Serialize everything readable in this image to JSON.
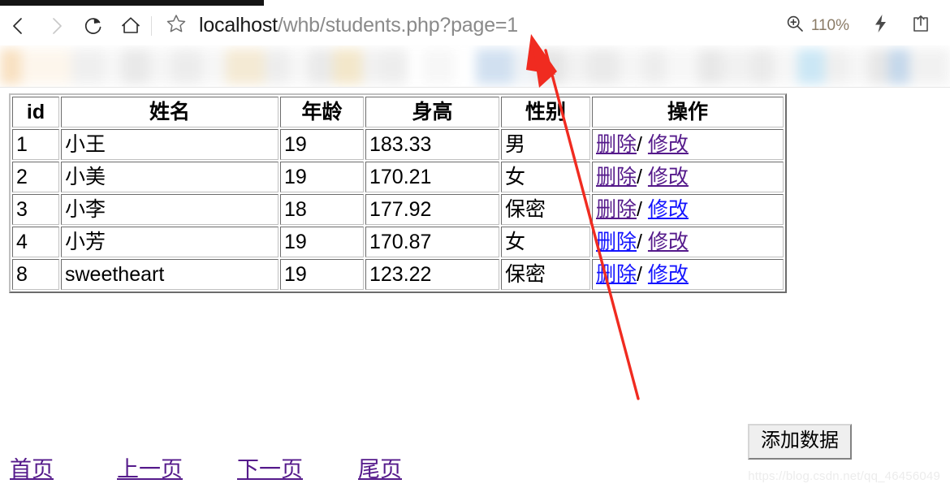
{
  "browser": {
    "back_icon": "chevron-left-icon",
    "forward_icon": "chevron-right-icon",
    "reload_icon": "reload-icon",
    "home_icon": "home-icon",
    "favorite_icon": "star-icon",
    "url_host": "localhost",
    "url_path": "/whb/students.php?page=1",
    "url_full": "localhost/whb/students.php?page=1",
    "zoom_icon": "zoom-in-icon",
    "zoom_level": "110%",
    "reading_view_icon": "lightning-bolt-icon",
    "share_icon": "share-icon"
  },
  "table": {
    "headers": [
      "id",
      "姓名",
      "年龄",
      "身高",
      "性别",
      "操作"
    ],
    "rows": [
      {
        "id": "1",
        "name": "小王",
        "age": "19",
        "height": "183.33",
        "gender": "男",
        "delete": "删除",
        "separator": "/",
        "edit": "修改",
        "delete_state": "visited",
        "edit_state": "visited"
      },
      {
        "id": "2",
        "name": "小美",
        "age": "19",
        "height": "170.21",
        "gender": "女",
        "delete": "删除",
        "separator": "/",
        "edit": "修改",
        "delete_state": "visited",
        "edit_state": "visited"
      },
      {
        "id": "3",
        "name": "小李",
        "age": "18",
        "height": "177.92",
        "gender": "保密",
        "delete": "删除",
        "separator": "/",
        "edit": "修改",
        "delete_state": "visited",
        "edit_state": "unvisited"
      },
      {
        "id": "4",
        "name": "小芳",
        "age": "19",
        "height": "170.87",
        "gender": "女",
        "delete": "删除",
        "separator": "/",
        "edit": "修改",
        "delete_state": "unvisited",
        "edit_state": "visited"
      },
      {
        "id": "8",
        "name": "sweetheart",
        "age": "19",
        "height": "123.22",
        "gender": "保密",
        "delete": "删除",
        "separator": "/",
        "edit": "修改",
        "delete_state": "unvisited",
        "edit_state": "unvisited"
      }
    ]
  },
  "actions": {
    "add_data_label": "添加数据"
  },
  "pagination": {
    "first": "首页",
    "previous": "上一页",
    "next": "下一页",
    "last": "尾页"
  },
  "watermark": "https://blog.csdn.net/qq_46456049",
  "annotation": {
    "arrow_color": "#f02b20",
    "arrow_target": "page=1"
  },
  "colors": {
    "link_visited": "#551a8b",
    "link_unvisited": "#1414ff",
    "zoom_text": "#8a7b66",
    "url_host": "#1a1a1a",
    "url_path": "#8a8a8a"
  }
}
